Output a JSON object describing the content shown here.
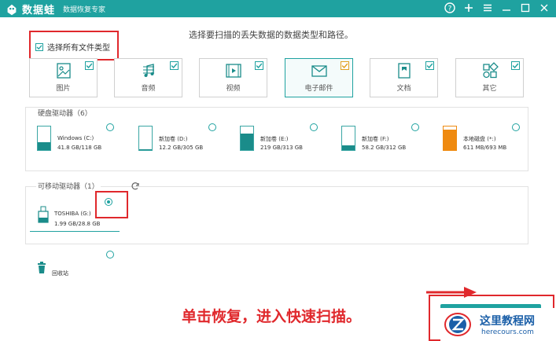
{
  "titlebar": {
    "app_name": "数据蛙",
    "subtitle": "数据恢复专家",
    "bg_color": "#1fa2a0",
    "buttons": [
      "help-icon",
      "plus-icon",
      "menu-icon",
      "minimize-icon",
      "maximize-icon",
      "close-icon"
    ]
  },
  "instruction": "选择要扫描的丢失数据的数据类型和路径。",
  "select_all": {
    "label": "选择所有文件类型",
    "checked": true
  },
  "file_types": [
    {
      "label": "图片",
      "icon": "image-icon",
      "checked": true
    },
    {
      "label": "音频",
      "icon": "music-icon",
      "checked": true
    },
    {
      "label": "视频",
      "icon": "video-icon",
      "checked": true
    },
    {
      "label": "电子邮件",
      "icon": "email-icon",
      "checked": true
    },
    {
      "label": "文档",
      "icon": "document-icon",
      "checked": true
    },
    {
      "label": "其它",
      "icon": "other-icon",
      "checked": true
    }
  ],
  "hard_drives": {
    "title": "硬盘驱动器（6）",
    "items": [
      {
        "name": "Windows (C:)",
        "size": "41.8 GB/118 GB",
        "used": 0.35,
        "color": "#1a8c8a"
      },
      {
        "name": "新加卷 (D:)",
        "size": "12.2 GB/305 GB",
        "used": 0.04,
        "color": "#1a8c8a"
      },
      {
        "name": "新加卷 (E:)",
        "size": "219 GB/313 GB",
        "used": 0.7,
        "color": "#1a8c8a"
      },
      {
        "name": "新加卷 (F:)",
        "size": "58.2 GB/312 GB",
        "used": 0.19,
        "color": "#1a8c8a"
      },
      {
        "name": "本地磁盘 (*:)",
        "size": "611 MB/693 MB",
        "used": 0.88,
        "color": "#ef8a10"
      }
    ]
  },
  "removable": {
    "title": "可移动驱动器（1）",
    "name": "TOSHIBA (G:)",
    "size": "1.99 GB/28.8 GB",
    "selected": true
  },
  "recycle": {
    "label": "回收站"
  },
  "annotation": "单击恢复，进入快速扫描。",
  "watermark": {
    "title": "这里教程网",
    "url": "herecours.com"
  }
}
